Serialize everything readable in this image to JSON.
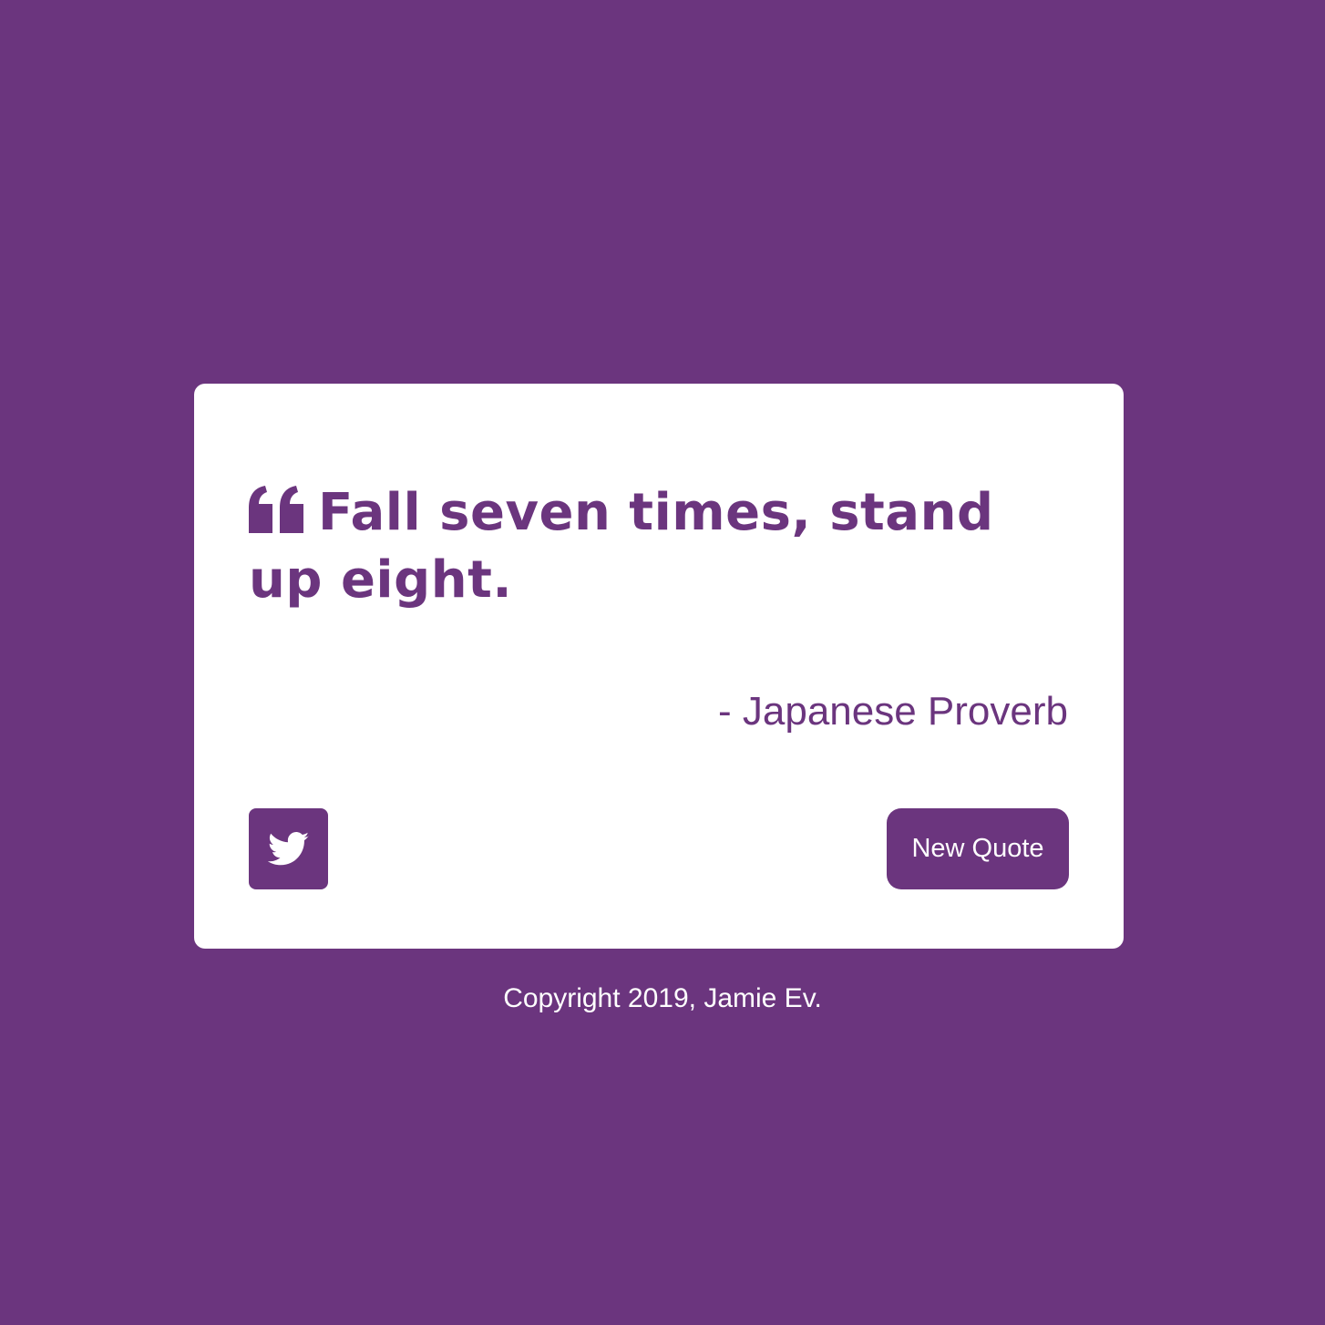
{
  "colors": {
    "background": "#6b357e",
    "card": "#ffffff",
    "accent": "#6b357e",
    "button_text": "#ffffff"
  },
  "quote_card": {
    "quote_icon": "quote-left-icon",
    "quote_text": "Fall seven times, stand up eight.",
    "author": "- Japanese Proverb",
    "tweet_button_icon": "twitter-icon",
    "new_quote_label": "New Quote"
  },
  "footer": {
    "copyright": "Copyright 2019, Jamie Ev."
  }
}
